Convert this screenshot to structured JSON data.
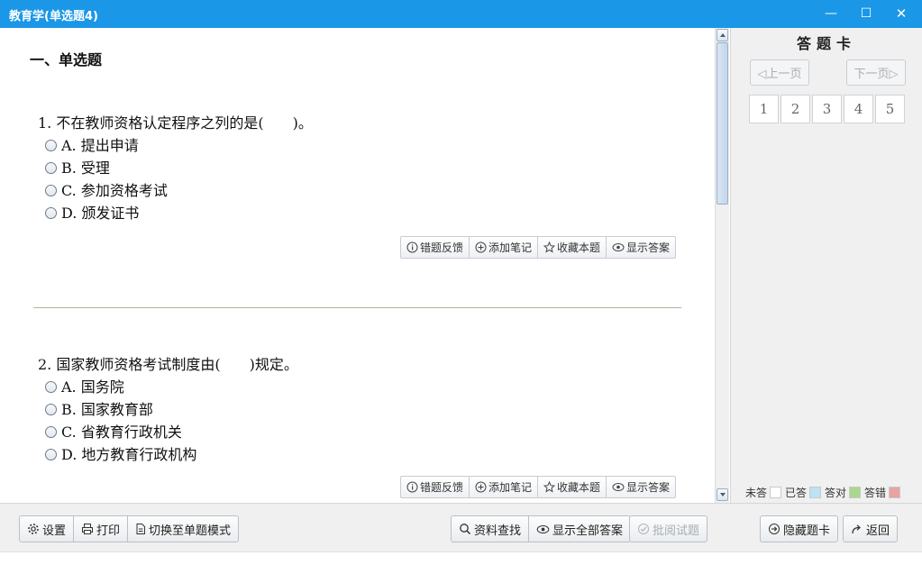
{
  "window": {
    "title": "教育学(单选题4)",
    "min_label": "—",
    "max_label": "☐",
    "close_label": "✕"
  },
  "section_title": "一、单选题",
  "questions": [
    {
      "text": "1. 不在教师资格认定程序之列的是(　　)。",
      "options": [
        "A. 提出申请",
        "B. 受理",
        "C. 参加资格考试",
        "D. 颁发证书"
      ]
    },
    {
      "text": "2. 国家教师资格考试制度由(　　)规定。",
      "options": [
        "A. 国务院",
        "B. 国家教育部",
        "C. 省教育行政机关",
        "D. 地方教育行政机构"
      ]
    }
  ],
  "question_tools": {
    "feedback": "错题反馈",
    "add_note": "添加笔记",
    "favorite": "收藏本题",
    "show_answer": "显示答案"
  },
  "answer_card": {
    "title": "答题卡",
    "prev": "◁上一页",
    "next": "下一页▷",
    "numbers": [
      "1",
      "2",
      "3",
      "4",
      "5"
    ],
    "legend": [
      {
        "label": "未答",
        "color": "#ffffff"
      },
      {
        "label": "已答",
        "color": "#bfe1f5"
      },
      {
        "label": "答对",
        "color": "#a8d88c"
      },
      {
        "label": "答错",
        "color": "#e9a3a3"
      }
    ]
  },
  "toolbar": {
    "settings": "设置",
    "print": "打印",
    "single_mode": "切换至单题模式",
    "search": "资料查找",
    "show_all": "显示全部答案",
    "review": "批阅试题",
    "hide_card": "隐藏题卡",
    "back": "返回"
  },
  "colors": {
    "titlebar": "#1a97e6",
    "panel_bg": "#f0f0f0",
    "divider": "#b9b09a"
  }
}
